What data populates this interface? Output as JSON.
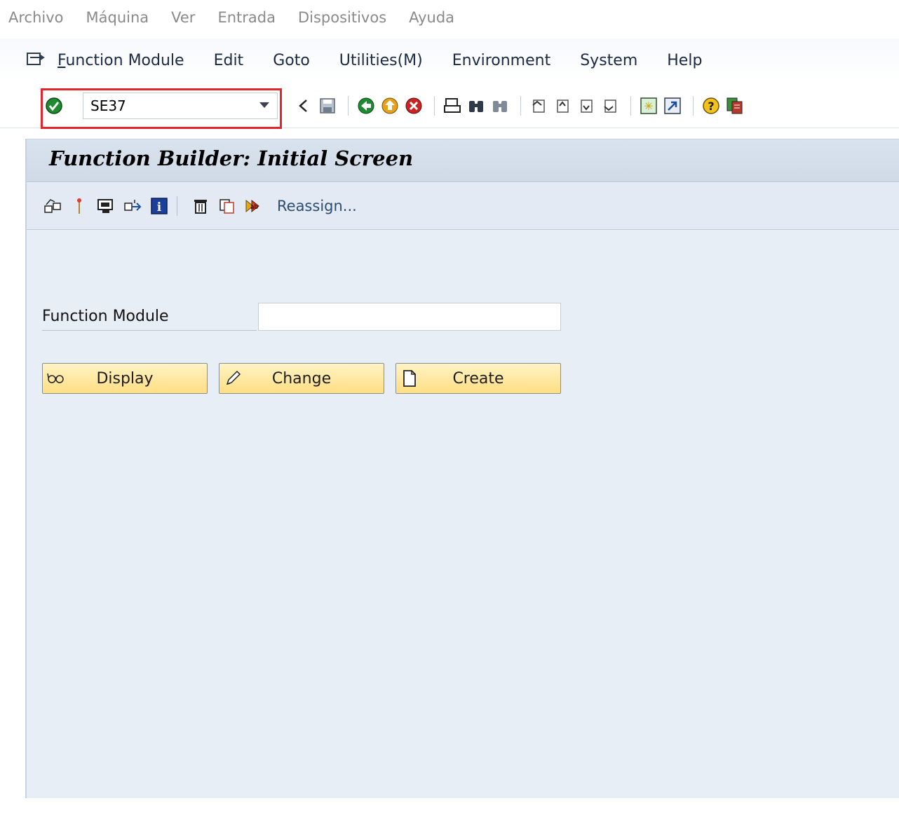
{
  "host_menu": [
    "Archivo",
    "Máquina",
    "Ver",
    "Entrada",
    "Dispositivos",
    "Ayuda"
  ],
  "sap_menu": [
    {
      "label": "Function Module",
      "mnemonic": "F"
    },
    {
      "label": "Edit",
      "mnemonic": "E"
    },
    {
      "label": "Goto",
      "mnemonic": "G"
    },
    {
      "label": "Utilities(M)",
      "mnemonic": "M"
    },
    {
      "label": "Environment",
      "mnemonic": "v"
    },
    {
      "label": "System",
      "mnemonic": "y"
    },
    {
      "label": "Help",
      "mnemonic": "H"
    }
  ],
  "command_field": {
    "value": "SE37"
  },
  "title": "Function Builder: Initial Screen",
  "app_toolbar": {
    "reassign_label": "Reassign..."
  },
  "form": {
    "function_module_label": "Function Module",
    "function_module_value": ""
  },
  "buttons": {
    "display": "Display",
    "change": "Change",
    "create": "Create"
  },
  "colors": {
    "highlight": "#e3262e",
    "content_bg": "#e8eef6",
    "button_bg": "#ffde83"
  }
}
